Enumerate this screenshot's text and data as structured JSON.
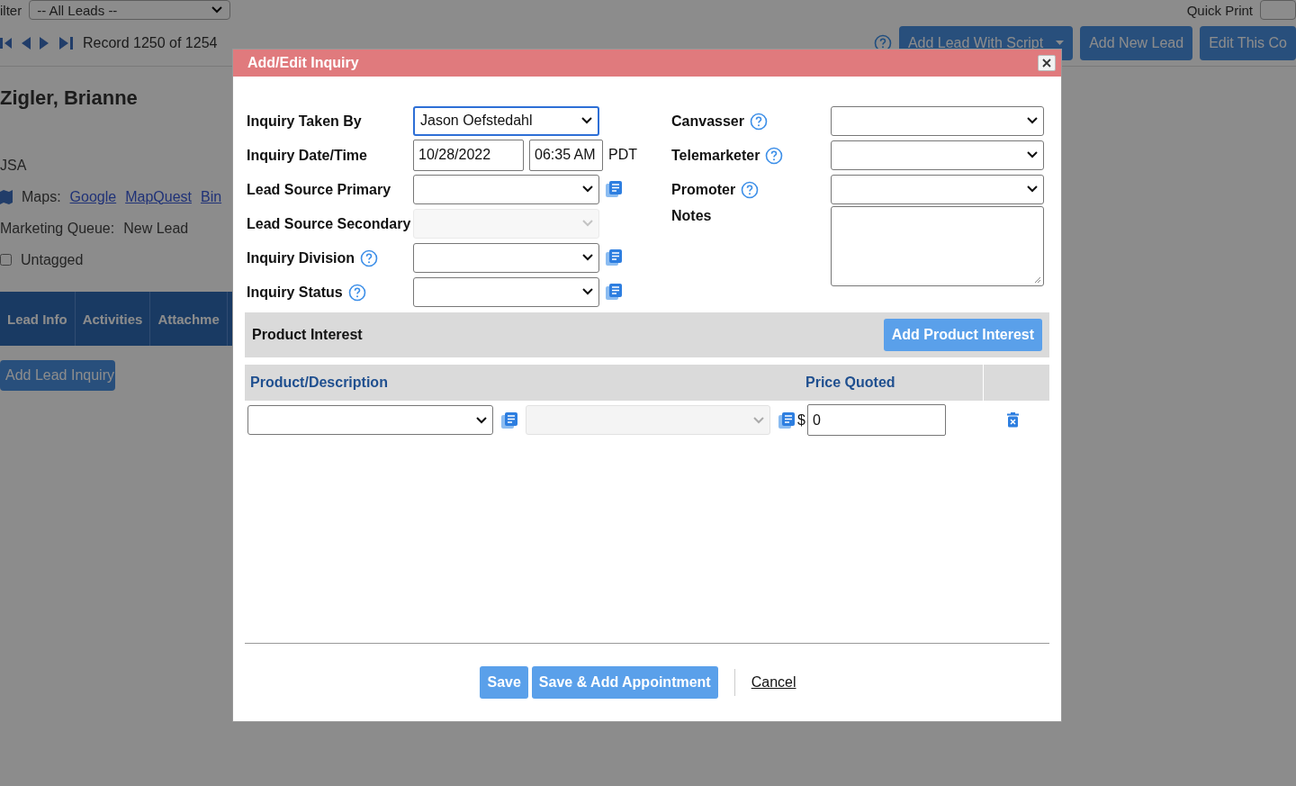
{
  "background": {
    "filter": {
      "label": "ilter",
      "value": "-- All Leads --"
    },
    "quick_print": {
      "label": "Quick Print"
    },
    "record_nav": {
      "text": "Record 1250 of 1254"
    },
    "toolbar_buttons": [
      {
        "label": "Add Lead With Script",
        "kind": "split"
      },
      {
        "label": "Add New Lead",
        "kind": "plain"
      },
      {
        "label": "Edit This Co",
        "kind": "plain"
      }
    ],
    "lead_name": "Zigler, Brianne",
    "country": "JSA",
    "maps": {
      "label": "Maps:",
      "links": [
        "Google",
        "MapQuest",
        "Bin"
      ]
    },
    "marketing_queue": {
      "label": "Marketing Queue:",
      "value": "New Lead"
    },
    "tag": {
      "label": "Untagged",
      "checked": false
    },
    "tabs": [
      "Lead Info",
      "Activities",
      "Attachme"
    ],
    "add_inquiry_button": "Add Lead Inquiry"
  },
  "dialog": {
    "title": "Add/Edit Inquiry",
    "left_fields": [
      {
        "label": "Inquiry Taken By",
        "kind": "select",
        "value": "Jason Oefstedahl",
        "help": false,
        "list_icon": false,
        "disabled": false,
        "focused": true
      },
      {
        "label": "Inquiry Date/Time",
        "kind": "datetime",
        "date": "10/28/2022",
        "time": "06:35 AM",
        "zone": "PDT",
        "help": false,
        "list_icon": false
      },
      {
        "label": "Lead Source Primary",
        "kind": "select",
        "help": false,
        "list_icon": true,
        "disabled": false,
        "focused": false
      },
      {
        "label": "Lead Source Secondary",
        "kind": "select",
        "help": false,
        "list_icon": false,
        "disabled": true,
        "focused": false
      },
      {
        "label": "Inquiry Division",
        "kind": "select",
        "help": true,
        "list_icon": true,
        "disabled": false,
        "focused": false
      },
      {
        "label": "Inquiry Status",
        "kind": "select",
        "help": true,
        "list_icon": true,
        "disabled": false,
        "focused": false
      }
    ],
    "right_fields": [
      {
        "label": "Canvasser",
        "kind": "select",
        "help": true,
        "list_icon": false,
        "disabled": false,
        "focused": false
      },
      {
        "label": "Telemarketer",
        "kind": "select",
        "help": true,
        "list_icon": false,
        "disabled": false,
        "focused": false
      },
      {
        "label": "Promoter",
        "kind": "select",
        "help": true,
        "list_icon": false,
        "disabled": false,
        "focused": false
      },
      {
        "label": "Notes",
        "kind": "textarea",
        "help": false,
        "list_icon": false
      }
    ],
    "product_interest": {
      "title": "Product Interest",
      "add_button": "Add Product Interest",
      "columns": [
        "Product/Description",
        "Price Quoted"
      ],
      "rows": [
        {
          "currency": "$",
          "price": "0"
        }
      ]
    },
    "buttons": [
      {
        "label": "Save",
        "kind": "primary"
      },
      {
        "label": "Save & Add Appointment",
        "kind": "primary"
      },
      {
        "label": "Cancel",
        "kind": "link"
      }
    ]
  }
}
